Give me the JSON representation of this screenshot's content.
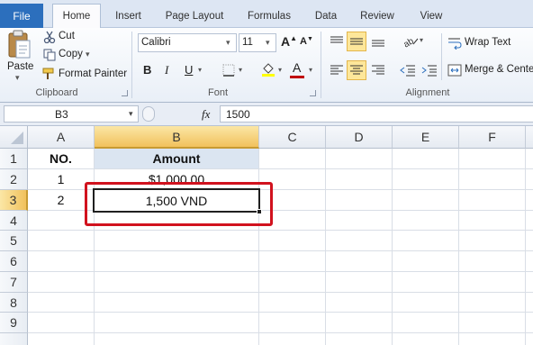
{
  "tabs": {
    "file": "File",
    "items": [
      "Home",
      "Insert",
      "Page Layout",
      "Formulas",
      "Data",
      "Review",
      "View"
    ],
    "active": "Home"
  },
  "clipboard": {
    "paste": "Paste",
    "cut": "Cut",
    "copy": "Copy",
    "format_painter": "Format Painter",
    "group_label": "Clipboard"
  },
  "font": {
    "name": "Calibri",
    "size": "11",
    "bold": "B",
    "italic": "I",
    "underline": "U",
    "grow": "A",
    "shrink": "A",
    "color_a": "A",
    "group_label": "Font",
    "font_color": "#c00000",
    "fill_color": "#ffff00"
  },
  "alignment": {
    "wrap_text": "Wrap Text",
    "merge_center": "Merge & Center",
    "group_label": "Alignment"
  },
  "formula_bar": {
    "name_box": "B3",
    "fx": "fx",
    "formula": "1500"
  },
  "sheet": {
    "columns": [
      "A",
      "B",
      "C",
      "D",
      "E",
      "F"
    ],
    "rows": [
      "1",
      "2",
      "3",
      "4",
      "5",
      "6",
      "7",
      "8",
      "9"
    ],
    "selected_cell": "B3",
    "cells": {
      "A1": "NO.",
      "B1": "Amount",
      "A2": "1",
      "B2": "$1,000.00",
      "A3": "2",
      "B3": "1,500 VND"
    },
    "highlight_color": "#d1121e"
  }
}
